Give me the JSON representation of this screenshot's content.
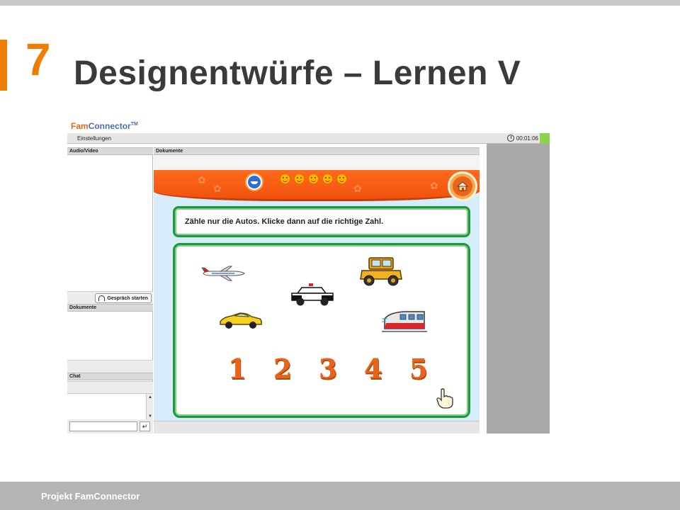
{
  "slide": {
    "number": "7",
    "title": "Designentwürfe – Lernen V",
    "footer": "Projekt FamConnector",
    "accent_color": "#f07d00"
  },
  "app": {
    "logo_fam": "Fam",
    "logo_connector": "Connector",
    "logo_tm": "TM",
    "menu": [
      "Einstellungen"
    ],
    "timer": "00:01:06",
    "panels": {
      "audio_video": "Audio/Video",
      "start_call_button": "Gespräch starten",
      "documents_left": "Dokumente",
      "chat": "Chat",
      "documents_main": "Dokumente"
    }
  },
  "game": {
    "instruction": "Zähle nur die Autos. Klicke dann auf die richtige Zahl.",
    "smiley_count": 5,
    "vehicles": [
      "airplane",
      "police-car",
      "vintage-car",
      "sports-car",
      "train"
    ],
    "answer_numbers": [
      "1",
      "2",
      "3",
      "4",
      "5"
    ],
    "banner_color": "#f0520f",
    "frame_color": "#1a9a3c"
  }
}
